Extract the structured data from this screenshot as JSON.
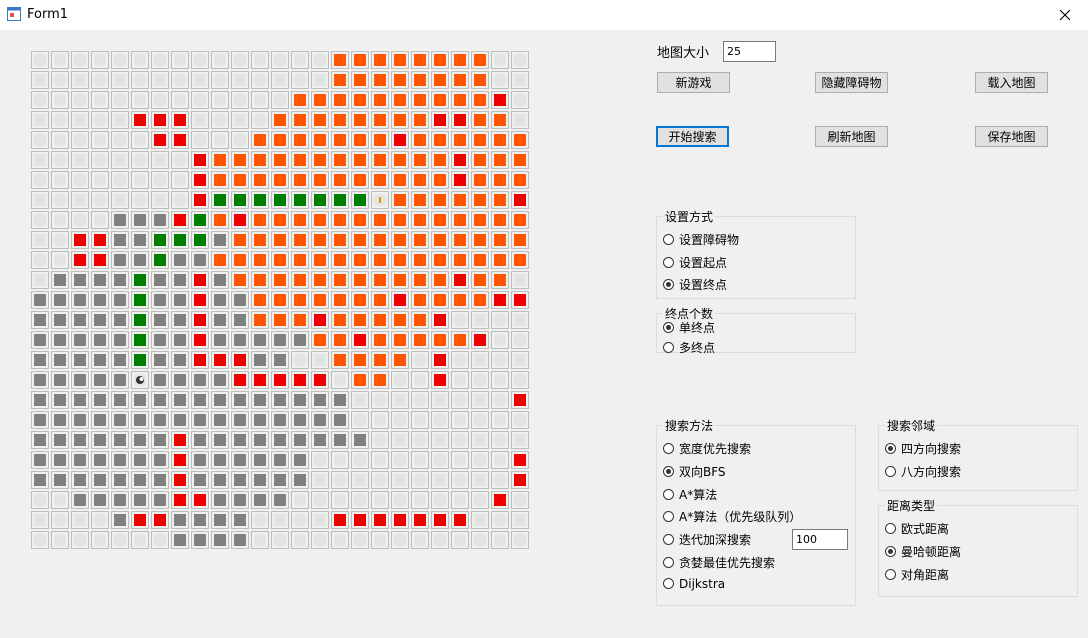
{
  "window": {
    "title": "Form1"
  },
  "colors": {
    "empty": "#e4e4e4",
    "obstacle": "#808080",
    "visited_orange": "#ff5500",
    "frontier_red": "#ee0000",
    "path_green": "#008000"
  },
  "grid": {
    "size": 25,
    "legend": ". empty, # obstacle, o visited, r frontier, g path, S start, E end",
    "rows": [
      "...............oooooooo...",
      "...............oooooooo...",
      ".............oooooooooor..",
      ".....rrr....oooooooorroo..",
      "......rr...oooooooroooooo",
      "........roooooooooooorooo.",
      "........roooooooooooorooor",
      "........rggggggggEooooooroo",
      "....###rgorooooooooooooooo",
      "..rr##ggg#oooooooooooooooo",
      "..rr##g##ooooooooooooooooo",
      ".####g##r#oooooooooooroo..",
      "#####g##r##oooooooroooorr..",
      "#####g##r##ooorooooor....",
      "#####g##r#####oorooooor....",
      "#####g##rrr##..oooo.r....",
      "#####S####rrrrr.oo..r....",
      "################........r....",
      "################.........r....",
      "#######r#########........r....",
      "#######r######..........r....",
      "#######r######..........r....",
      "..#####rr####..........r....",
      "....#rr####....rrrrrrr.....",
      ".......####..............."
    ]
  },
  "map_size": {
    "label": "地图大小",
    "value": "25"
  },
  "buttons": {
    "new_game": "新游戏",
    "hide_obstacles": "隐藏障碍物",
    "load_map": "载入地图",
    "start_search": "开始搜索",
    "refresh_map": "刷新地图",
    "save_map": "保存地图"
  },
  "set_mode": {
    "title": "设置方式",
    "options": [
      "设置障碍物",
      "设置起点",
      "设置终点"
    ],
    "selected": 2
  },
  "end_count": {
    "title": "终点个数",
    "options": [
      "单终点",
      "多终点"
    ],
    "selected": 0
  },
  "search_method": {
    "title": "搜索方法",
    "options": [
      "宽度优先搜索",
      "双向BFS",
      "A*算法",
      "A*算法（优先级队列）",
      "迭代加深搜索",
      "贪婪最佳优先搜索",
      "Dijkstra"
    ],
    "selected": 1,
    "depth_value": "100"
  },
  "neighborhood": {
    "title": "搜索邻域",
    "options": [
      "四方向搜索",
      "八方向搜索"
    ],
    "selected": 0
  },
  "distance": {
    "title": "距离类型",
    "options": [
      "欧式距离",
      "曼哈顿距离",
      "对角距离"
    ],
    "selected": 1
  }
}
